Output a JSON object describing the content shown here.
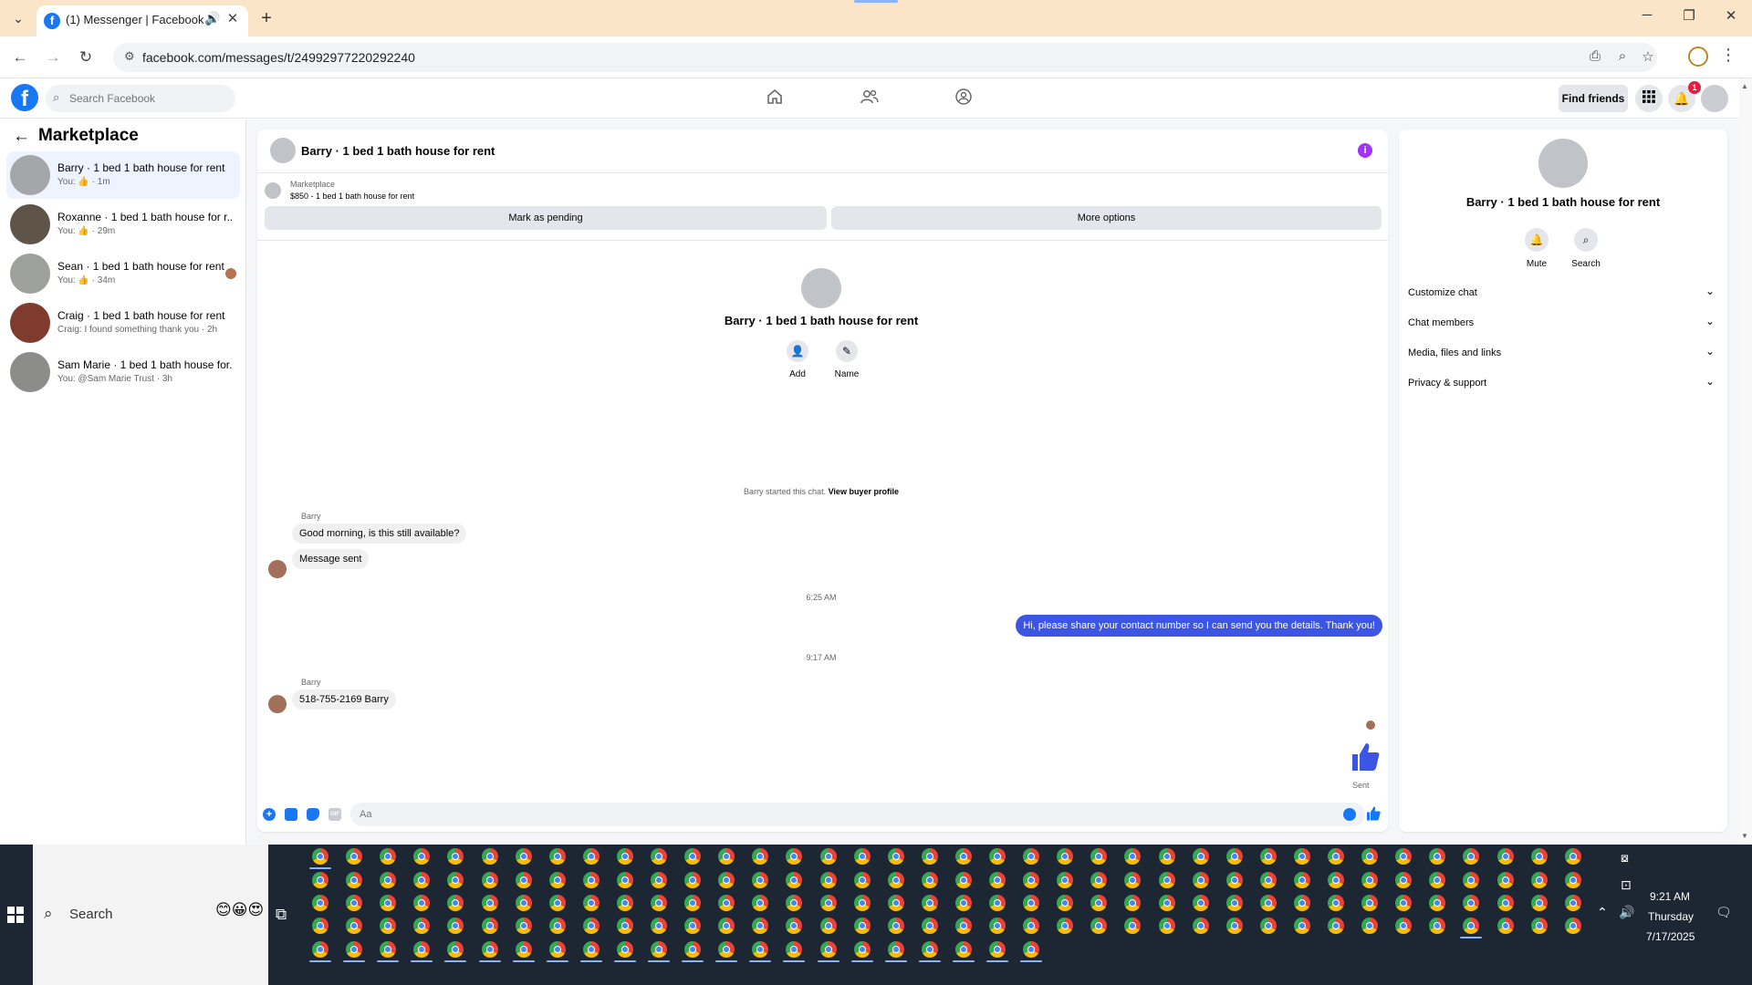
{
  "browser": {
    "tab_title": "(1) Messenger | Facebook",
    "tab_favicon": "f",
    "url": "facebook.com/messages/t/24992977220292240"
  },
  "fb": {
    "logo": "f",
    "search_placeholder": "Search Facebook",
    "find_friends": "Find friends",
    "notification_count": "1"
  },
  "left": {
    "title": "Marketplace",
    "conversations": [
      {
        "name": "Barry · 1 bed 1 bath house for rent",
        "sub": "You: 👍 · 1m",
        "active": true,
        "color": "#a4a6aa"
      },
      {
        "name": "Roxanne · 1 bed 1 bath house for r...",
        "sub": "You: 👍 · 29m",
        "active": false,
        "color": "#5e5447"
      },
      {
        "name": "Sean · 1 bed 1 bath house for rent",
        "sub": "You: 👍 · 34m",
        "active": false,
        "color": "#9ea09c"
      },
      {
        "name": "Craig · 1 bed 1 bath house for rent",
        "sub": "Craig: I found something thank you · 2h",
        "active": false,
        "color": "#7e3b2e"
      },
      {
        "name": "Sam Marie · 1 bed 1 bath house for...",
        "sub": "You: @Sam Marie Trust · 3h",
        "active": false,
        "color": "#8c8d89"
      }
    ]
  },
  "chat": {
    "title": "Barry · 1 bed 1 bath house for rent",
    "listing_kicker": "Marketplace",
    "listing_price": "$850 - 1 bed 1 bath house for rent",
    "mark_pending": "Mark as pending",
    "more_options": "More options",
    "intro_title": "Barry · 1 bed 1 bath house for rent",
    "add_label": "Add",
    "name_label": "Name",
    "started_text": "Barry started this chat.",
    "view_profile": "View buyer profile",
    "sender1": "Barry",
    "msg1": "Good morning, is this still available?",
    "msg2": "Message sent",
    "time1": "6:25 AM",
    "msg_out": "Hi, please share your contact number so I can send you the details. Thank you!",
    "time2": "9:17 AM",
    "sender2": "Barry",
    "msg3": "518-755-2169 Barry",
    "sent_label": "Sent",
    "input_placeholder": "Aa",
    "accent": "#3d55e3"
  },
  "details": {
    "title": "Barry · 1 bed 1 bath house for rent",
    "mute": "Mute",
    "search": "Search",
    "rows": [
      "Customize chat",
      "Chat members",
      "Media, files and links",
      "Privacy & support"
    ]
  },
  "taskbar": {
    "search_label": "Search",
    "emoji": "😊😀😍",
    "time": "9:21 AM",
    "day": "Thursday",
    "date": "7/17/2025",
    "app_icon": "chrome-icon",
    "rows": [
      {
        "count": 38,
        "active": [
          0
        ]
      },
      {
        "count": 38,
        "active": []
      },
      {
        "count": 38,
        "active": []
      },
      {
        "count": 38,
        "active": [
          34
        ]
      },
      {
        "count": 22,
        "active": [
          0,
          1,
          2,
          3,
          4,
          5,
          6,
          7,
          8,
          9,
          10,
          11,
          12,
          13,
          14,
          15,
          16,
          17,
          18,
          19,
          20,
          21
        ]
      }
    ]
  }
}
